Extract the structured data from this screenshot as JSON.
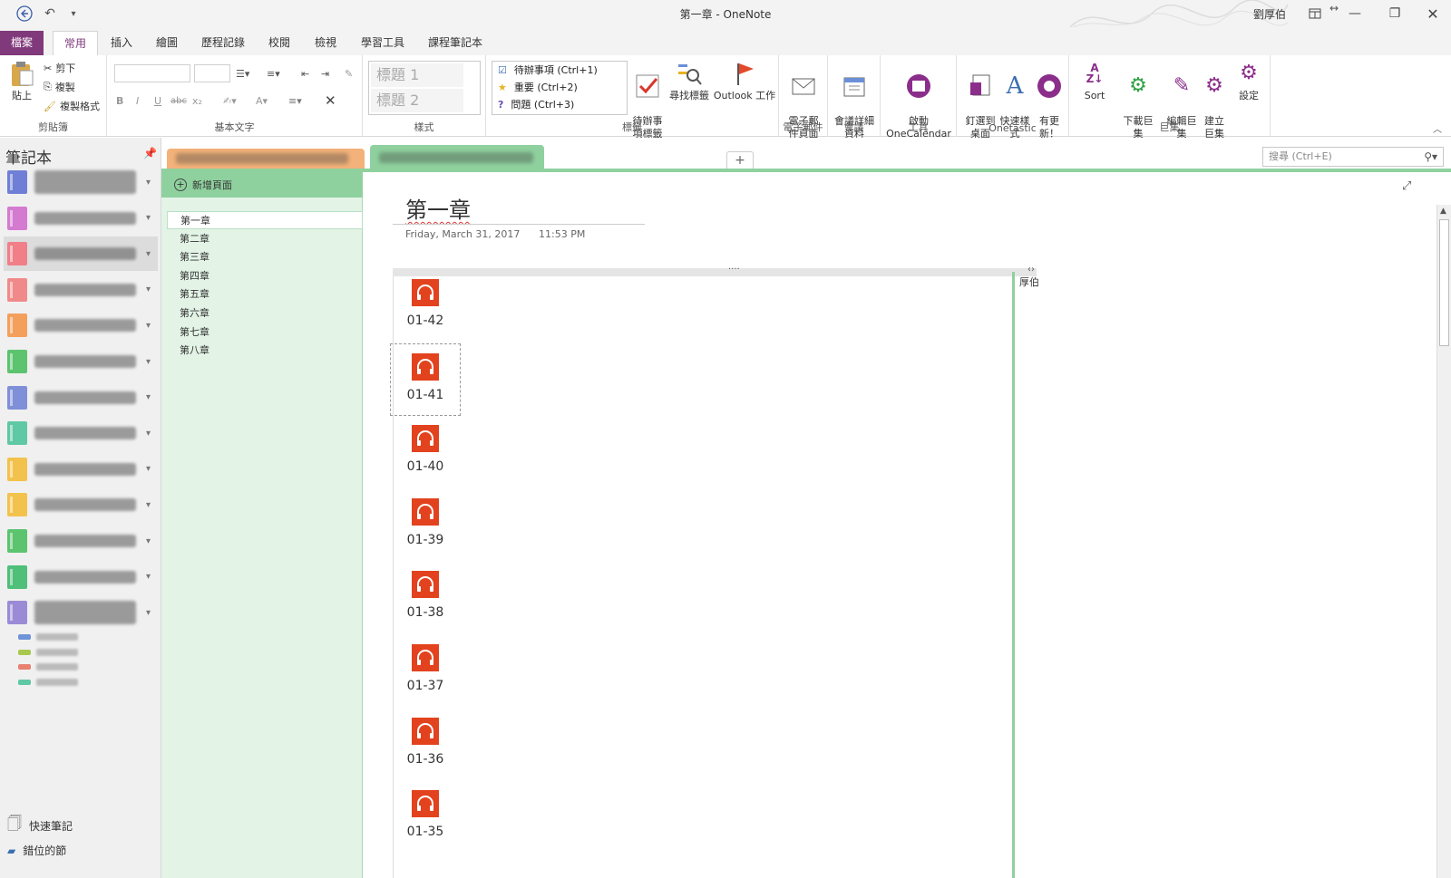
{
  "app": {
    "title": "第一章 - OneNote",
    "user": "劉厚伯"
  },
  "ribbon_tabs": [
    "檔案",
    "常用",
    "插入",
    "繪圖",
    "歷程記錄",
    "校閱",
    "檢視",
    "學習工具",
    "課程筆記本"
  ],
  "ribbon": {
    "clipboard": {
      "paste": "貼上",
      "cut": "剪下",
      "copy": "複製",
      "format_painter": "複製格式",
      "label": "剪貼簿"
    },
    "basic_text": {
      "label": "基本文字",
      "bold": "B",
      "italic": "I",
      "underline": "U",
      "strike": "abc",
      "subscript": "x₂",
      "clear": "✕"
    },
    "styles": {
      "label": "樣式",
      "heading1": "標題 1",
      "heading2": "標題 2"
    },
    "tags": {
      "label": "標籤",
      "items": [
        "待辦事項 (Ctrl+1)",
        "重要 (Ctrl+2)",
        "問題 (Ctrl+3)"
      ],
      "todo_tag": "待辦事\n項標籤",
      "find_tags": "尋找標籤",
      "outlook_task": "Outlook 工作"
    },
    "email": {
      "label": "電子郵件",
      "email_page": "電子郵\n件頁面"
    },
    "meetings": {
      "label": "會議",
      "meeting_details": "會議詳細\n資料"
    },
    "tools": {
      "label": "工具",
      "onecalendar": "啟動\nOneCalendar"
    },
    "onetastic": {
      "label": "Onetastic",
      "pin": "釘選到\n桌面",
      "quick_style": "快速樣\n式",
      "update": "有更\n新！"
    },
    "macros": {
      "label": "巨集",
      "sort": "Sort",
      "download": "下載巨\n集",
      "edit": "編輯巨\n集",
      "create": "建立\n巨集",
      "settings": "設定"
    }
  },
  "notebook_pane": {
    "header": "筆記本",
    "notebooks": [
      {
        "color": "#6f7fd6",
        "lines": 2
      },
      {
        "color": "#d47ad0",
        "lines": 1
      },
      {
        "color": "#f07f88",
        "lines": 1,
        "selected": true
      },
      {
        "color": "#f08a8a",
        "lines": 1
      },
      {
        "color": "#f3a05c",
        "lines": 1
      },
      {
        "color": "#5cc36e",
        "lines": 1
      },
      {
        "color": "#7f90d8",
        "lines": 1
      },
      {
        "color": "#5fc8a4",
        "lines": 1
      },
      {
        "color": "#f3c24c",
        "lines": 1
      },
      {
        "color": "#f3c24c",
        "lines": 1
      },
      {
        "color": "#5cc36e",
        "lines": 1
      },
      {
        "color": "#4fbf7a",
        "lines": 1
      },
      {
        "color": "#9b8ad6",
        "lines": 2
      }
    ],
    "subsections": [
      "#6f93d8",
      "#a8c84f",
      "#e8806f",
      "#5fc8a4"
    ],
    "quick_notes": "快速筆記",
    "misplaced_sections": "錯位的節"
  },
  "section_tabs": [
    {
      "color": "#f3b27a"
    },
    {
      "color": "#8fd19e",
      "active": true
    }
  ],
  "search": {
    "placeholder": "搜尋 (Ctrl+E)"
  },
  "page_list": {
    "add_page": "新增頁面",
    "pages": [
      "第一章",
      "第二章",
      "第三章",
      "第四章",
      "第五章",
      "第六章",
      "第七章",
      "第八章"
    ],
    "selected_index": 0
  },
  "page": {
    "title": "第一章",
    "date": "Friday, March 31, 2017",
    "time": "11:53 PM",
    "side_note": "厚伯",
    "audio_clips": [
      "01-42",
      "01-41",
      "01-40",
      "01-39",
      "01-38",
      "01-37",
      "01-36",
      "01-35"
    ],
    "selected_clip": "01-41"
  },
  "colors": {
    "file_tab": "#80397b",
    "section_green": "#8fd19e",
    "page_list_bg": "#e3f4e7",
    "audio_icon": "#e2431e"
  }
}
